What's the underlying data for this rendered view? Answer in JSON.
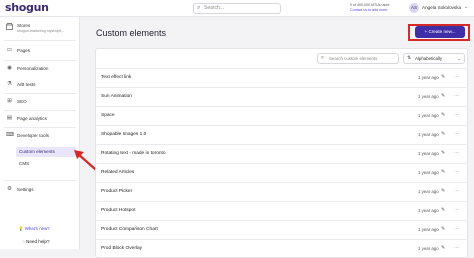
{
  "topbar": {
    "logo": "shogun",
    "search_placeholder": "Search...",
    "usage_text": "0 of 400,000 MTUs used",
    "usage_link": "Contact us to add more",
    "avatar_initials": "AS",
    "user_name": "Angela Sokolovska"
  },
  "sidebar": {
    "store_label": "Stores",
    "store_sub": "shogun-marketing.myshopif...",
    "items": [
      {
        "label": "Pages"
      },
      {
        "label": "Personalization"
      },
      {
        "label": "A/B tests"
      },
      {
        "label": "SEO"
      },
      {
        "label": "Page analytics"
      },
      {
        "label": "Developer tools"
      }
    ],
    "sub_items": [
      {
        "label": "Custom elements"
      },
      {
        "label": "CMS"
      }
    ],
    "settings_label": "Settings",
    "whats_new": "What's new?",
    "need_help": "Need help?"
  },
  "main": {
    "title": "Custom elements",
    "create_button": "Create new...",
    "search_placeholder": "Search custom elements",
    "sort_label": "Alphabetically"
  },
  "rows": [
    {
      "name": "Text effect link",
      "date": "1 year ago"
    },
    {
      "name": "Sun Animation",
      "date": "1 year ago"
    },
    {
      "name": "Space",
      "date": "1 year ago"
    },
    {
      "name": "Shopable Images 1.0",
      "date": "1 year ago"
    },
    {
      "name": "Rotating text - made in toronto",
      "date": "1 year ago"
    },
    {
      "name": "Related Articles",
      "date": "1 year ago"
    },
    {
      "name": "Product Picker",
      "date": "1 year ago"
    },
    {
      "name": "Product Hotspot",
      "date": "1 year ago"
    },
    {
      "name": "Product Comparison Chart",
      "date": "1 year ago"
    },
    {
      "name": "Prod Block Overlay",
      "date": "1 year ago"
    }
  ],
  "colors": {
    "brand": "#3f2ea6",
    "highlight": "#d42a2a",
    "active_nav_bg": "#e9e6fb"
  }
}
